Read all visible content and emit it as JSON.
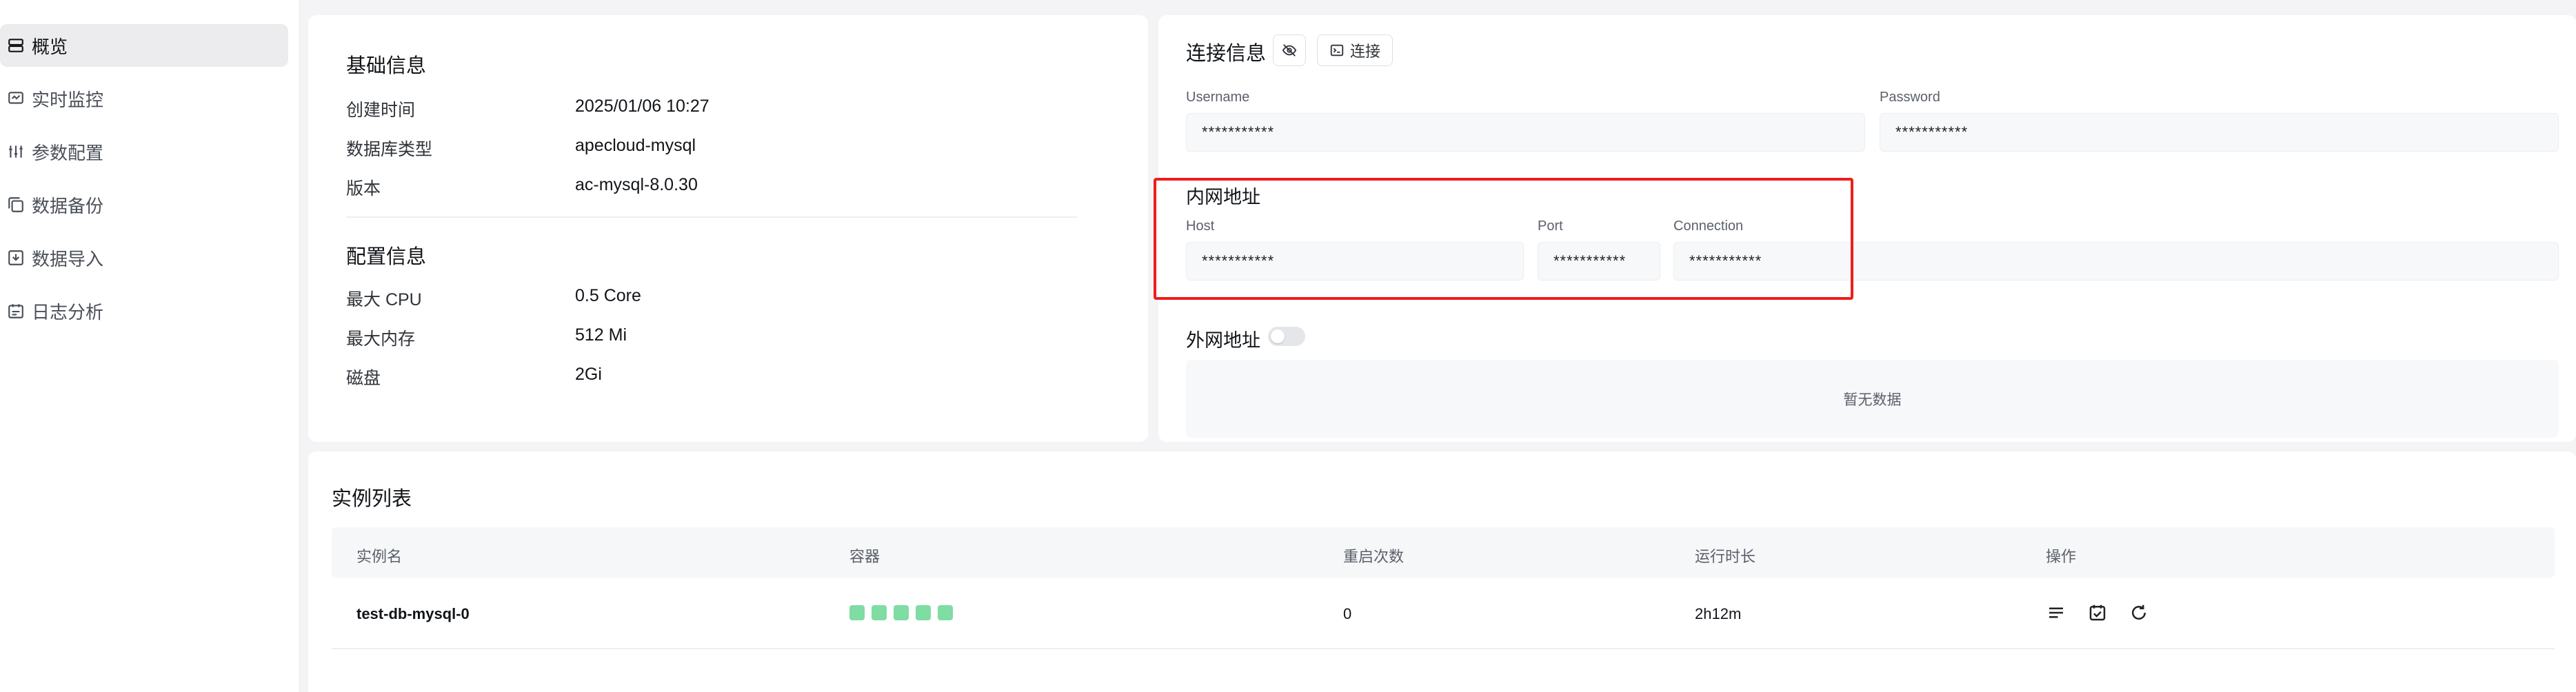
{
  "sidebar": {
    "items": [
      {
        "label": "概览",
        "icon": "server-icon",
        "active": true
      },
      {
        "label": "实时监控",
        "icon": "monitor-icon",
        "active": false
      },
      {
        "label": "参数配置",
        "icon": "sliders-icon",
        "active": false
      },
      {
        "label": "数据备份",
        "icon": "backup-icon",
        "active": false
      },
      {
        "label": "数据导入",
        "icon": "import-icon",
        "active": false
      },
      {
        "label": "日志分析",
        "icon": "calendar-log-icon",
        "active": false
      }
    ]
  },
  "basic_info": {
    "title": "基础信息",
    "rows": [
      {
        "key": "创建时间",
        "value": "2025/01/06 10:27"
      },
      {
        "key": "数据库类型",
        "value": "apecloud-mysql"
      },
      {
        "key": "版本",
        "value": "ac-mysql-8.0.30"
      }
    ]
  },
  "config_info": {
    "title": "配置信息",
    "rows": [
      {
        "key": "最大 CPU",
        "value": "0.5 Core"
      },
      {
        "key": "最大内存",
        "value": "512 Mi"
      },
      {
        "key": "磁盘",
        "value": "2Gi"
      }
    ]
  },
  "connection": {
    "title": "连接信息",
    "connect_label": "连接",
    "username_label": "Username",
    "username_value": "***********",
    "password_label": "Password",
    "password_value": "***********",
    "internal": {
      "title": "内网地址",
      "host_label": "Host",
      "host_value": "***********",
      "port_label": "Port",
      "port_value": "***********",
      "connection_label": "Connection",
      "connection_value": "***********"
    },
    "external": {
      "title": "外网地址",
      "enabled": false,
      "empty_text": "暂无数据"
    },
    "highlight_color": "#ef1c1c"
  },
  "instances": {
    "title": "实例列表",
    "columns": [
      "实例名",
      "容器",
      "重启次数",
      "运行时长",
      "操作"
    ],
    "rows": [
      {
        "name": "test-db-mysql-0",
        "containers": 5,
        "container_color": "#7fdca3",
        "restarts": "0",
        "uptime": "2h12m",
        "actions": [
          "list-icon",
          "calendar-icon",
          "refresh-icon"
        ]
      }
    ]
  }
}
